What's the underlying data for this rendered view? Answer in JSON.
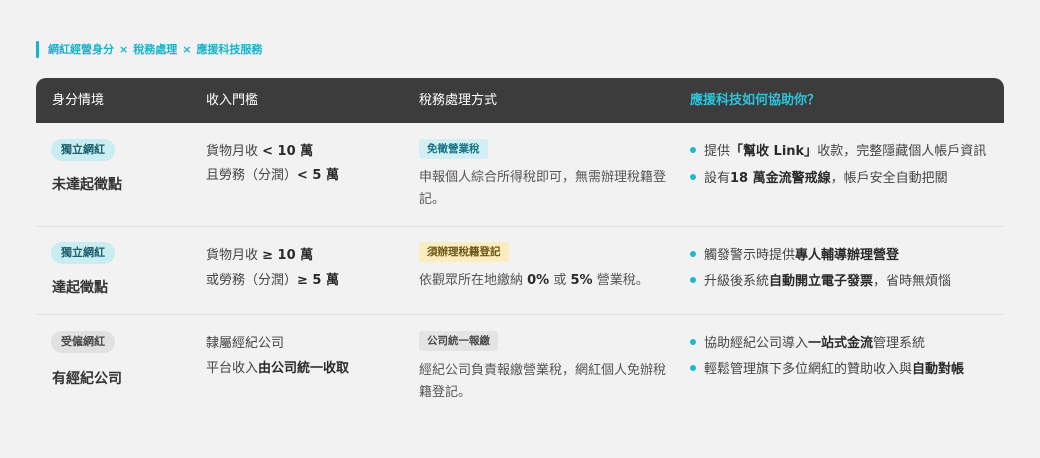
{
  "breadcrumb": {
    "parts": [
      "網紅經營身分",
      "稅務處理",
      "應援科技服務"
    ],
    "separator": "×"
  },
  "colors": {
    "accent": "#19b3cc",
    "header_bg": "#3c3c3c",
    "page_bg": "#f2f2f2"
  },
  "header": {
    "identity": "身分情境",
    "income": "收入門檻",
    "tax": "稅務處理方式",
    "help": "應援科技如何協助你？"
  },
  "rows": [
    {
      "badge": "獨立網紅",
      "identity": "未達起徵點",
      "income_line1": {
        "a": "貨物月收 ",
        "b": "< 10 萬"
      },
      "income_line2": {
        "a": "且勞務（分潤）",
        "b": "< 5 萬"
      },
      "tax_tag": "免徵營業稅",
      "tax_desc": "申報個人綜合所得稅即可，無需辦理稅籍登記。",
      "help1": {
        "a": "提供",
        "b": "「幫收 Link」",
        "c": "收款，完整隱藏個人帳戶資訊"
      },
      "help2": {
        "a": "設有 ",
        "b": "18 萬金流警戒線",
        "c": "，帳戶安全自動把關"
      }
    },
    {
      "badge": "獨立網紅",
      "identity": "達起徵點",
      "income_line1": {
        "a": "貨物月收 ",
        "b": "≥ 10 萬"
      },
      "income_line2": {
        "a": "或勞務（分潤）",
        "b": "≥ 5 萬"
      },
      "tax_tag": "須辦理稅籍登記",
      "tax_desc": {
        "a": "依觀眾所在地繳納 ",
        "b": "0%",
        "c": " 或 ",
        "d": "5%",
        "e": " 營業稅。"
      },
      "help1": {
        "a": "觸發警示時提供",
        "b": "專人輔導辦理營登",
        "c": ""
      },
      "help2": {
        "a": "升級後系統",
        "b": "自動開立電子發票",
        "c": "，省時無煩惱"
      }
    },
    {
      "badge": "受僱網紅",
      "identity": "有經紀公司",
      "income_line1": {
        "a": "隸屬經紀公司",
        "b": ""
      },
      "income_line2": {
        "a": "平台收入",
        "b": "由公司統一收取"
      },
      "tax_tag": "公司統一報繳",
      "tax_desc": "經紀公司負責報繳營業稅，網紅個人免辦稅籍登記。",
      "help1": {
        "a": "協助經紀公司導入",
        "b": "一站式金流",
        "c": "管理系統"
      },
      "help2": {
        "a": "輕鬆管理旗下多位網紅的贊助收入與",
        "b": "自動對帳",
        "c": ""
      }
    }
  ]
}
